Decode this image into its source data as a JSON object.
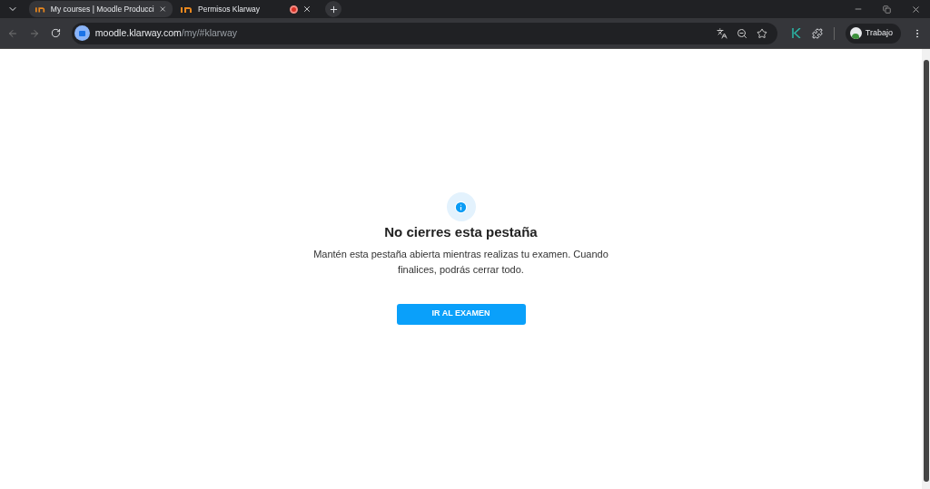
{
  "tabs": [
    {
      "title": "My courses | Moodle Producci",
      "selected": true,
      "recording": false
    },
    {
      "title": "Permisos Klarway",
      "selected": false,
      "recording": true
    }
  ],
  "address": {
    "host": "moodle.klarway.com",
    "path": "/my/#klarway"
  },
  "profile": {
    "label": "Trabajo"
  },
  "page": {
    "heading": "No cierres esta pestaña",
    "message": "Mantén esta pestaña abierta mientras realizas tu examen. Cuando finalices, podrás cerrar todo.",
    "button": "IR AL EXAMEN"
  }
}
